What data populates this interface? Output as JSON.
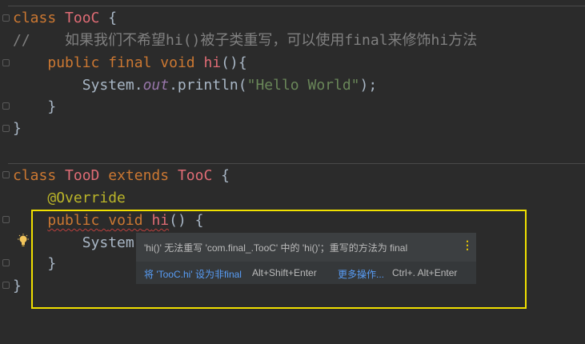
{
  "code": {
    "l1": {
      "kw": "class",
      "name": "TooC",
      "brace": "{"
    },
    "l2": {
      "comment": "//    如果我们不希望hi()被子类重写，可以使用final来修饰hi方法"
    },
    "l3": {
      "kw1": "public",
      "kw2": "final",
      "kw3": "void",
      "name": "hi",
      "rest": "(){"
    },
    "l4": {
      "sys": "System.",
      "out": "out",
      "dot": ".println(",
      "str": "\"Hello World\"",
      "end": ");"
    },
    "l5": {
      "brace": "}"
    },
    "l6": {
      "brace": "}"
    },
    "l7": {
      "kw": "class",
      "name": "TooD",
      "ext": "extends",
      "parent": "TooC",
      "brace": "{"
    },
    "l8": {
      "ann": "@Override"
    },
    "l9": {
      "kw1": "public",
      "kw2": "void",
      "name": "hi",
      "rest": "() {"
    },
    "l10": {
      "sys": "System"
    },
    "l11": {
      "brace": "}"
    },
    "l12": {
      "brace": "}"
    }
  },
  "popup": {
    "message": "'hi()' 无法重写 'com.final_.TooC' 中的 'hi()'；重写的方法为 final",
    "more_icon": "⋮",
    "action1": "将 'TooC.hi' 设为非final",
    "action1_key": "Alt+Shift+Enter",
    "action2": "更多操作...",
    "action2_key": "Ctrl+. Alt+Enter"
  },
  "colors": {
    "highlight": "#f0e000",
    "background": "#2b2b2b",
    "link": "#589df6"
  }
}
